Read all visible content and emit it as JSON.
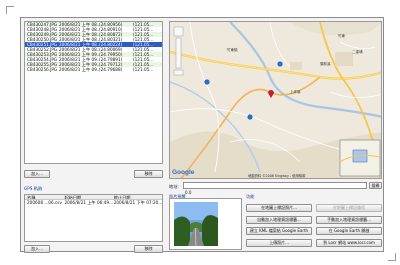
{
  "file_table": {
    "rows": [
      {
        "name": "CB430247.JPG",
        "date": "2006/8/21 上午 08...",
        "lat": "(24.80956)",
        "lng": "(121.05..."
      },
      {
        "name": "CB430248.JPG",
        "date": "2006/8/21 上午 08...",
        "lat": "(24.80910)",
        "lng": "(121.05..."
      },
      {
        "name": "CB430249.JPG",
        "date": "2006/8/21 上午 08...",
        "lat": "(24.80872)",
        "lng": "(121.05..."
      },
      {
        "name": "CB430250.JPG",
        "date": "2006/8/21 上午 08...",
        "lat": "(24.80321)",
        "lng": "(121.05..."
      },
      {
        "name": "CB430251.JPG",
        "date": "2006/8/21 上午 08...",
        "lat": "(24.80224)",
        "lng": "(121.05..."
      },
      {
        "name": "CB430252.JPG",
        "date": "2006/8/21 上午 08...",
        "lat": "(24.80069)",
        "lng": "(121.05..."
      },
      {
        "name": "CB430253.JPG",
        "date": "2006/8/21 上午 09...",
        "lat": "(24.79950)",
        "lng": "(121.05..."
      },
      {
        "name": "CB430254.JPG",
        "date": "2006/8/21 上午 09...",
        "lat": "(24.79891)",
        "lng": "(121.05..."
      },
      {
        "name": "CB430255.JPG",
        "date": "2006/8/21 上午 09...",
        "lat": "(24.79712)",
        "lng": "(121.05..."
      },
      {
        "name": "CB430256.JPG",
        "date": "2006/8/21 上午 09...",
        "lat": "(24.79688)",
        "lng": "(121.05..."
      }
    ],
    "selected_index": 4
  },
  "left_buttons": {
    "add": "加入...",
    "remove": "移除"
  },
  "path_section": {
    "title": "GPS 軌跡",
    "headers": [
      "名稱",
      "起始日期",
      "終止日期"
    ],
    "rows": [
      {
        "name": "200608 ...06.csv",
        "start": "2006/8/21 上午 06:49...",
        "end": "2006/8/21 下午 07:20..."
      }
    ],
    "add": "加入...",
    "remove": "移除"
  },
  "map": {
    "logo": "Google",
    "copyright": "地圖資料 ©2006 Kingway - 使用條款",
    "labels": [
      "竹東鎮",
      "頭前溪",
      "上坪溪",
      "竹東",
      "二重埔"
    ]
  },
  "address": {
    "label": "地址:",
    "value": "",
    "coords": "0.0"
  },
  "photo_section": {
    "title": "照片預覽"
  },
  "actions": {
    "title": "功能",
    "buttons": [
      {
        "label": "在地圖上標記照片...",
        "enabled": true
      },
      {
        "label": "在地圖上標記路徑",
        "enabled": false
      },
      {
        "label": "自動加入地理資訊標籤...",
        "enabled": true
      },
      {
        "label": "手動加入地理資訊標籤...",
        "enabled": true
      },
      {
        "label": "建立 KML 檔案給 Google Earth",
        "enabled": true
      },
      {
        "label": "在 Google Earth 開啟",
        "enabled": true
      },
      {
        "label": "上傳照片...",
        "enabled": true
      },
      {
        "label": "到 Locr 網站 www.locr.com",
        "enabled": true
      }
    ]
  },
  "colors": {
    "selected_row": "#2c5cc8",
    "stripe_row": "#eaf6e4",
    "section_title": "#1e3f9c"
  }
}
